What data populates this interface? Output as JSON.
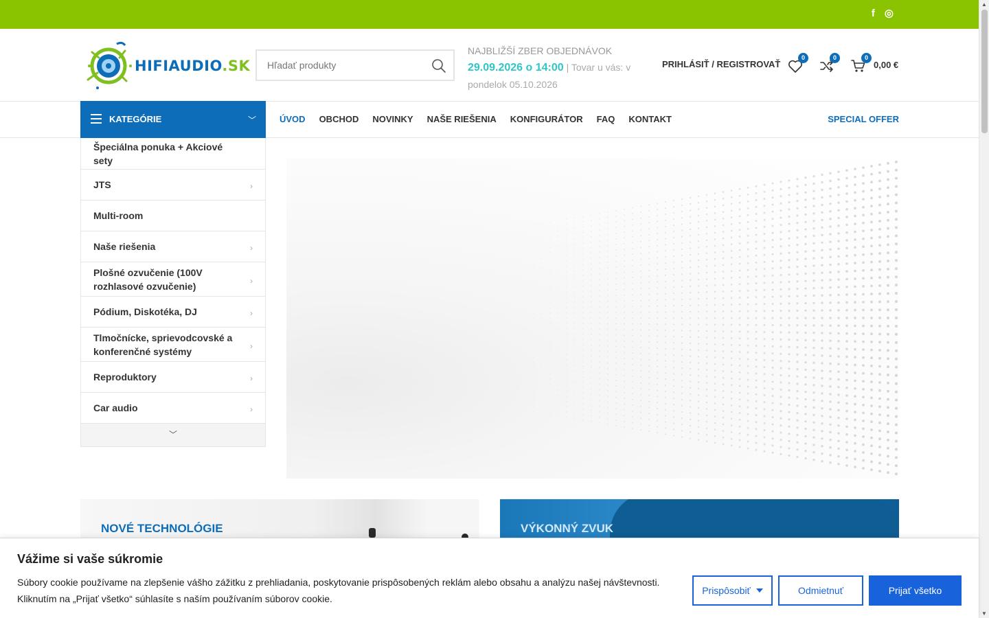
{
  "colors": {
    "topbar": "#8ac300",
    "primary": "#0e6db8",
    "delivery_date": "#2ec6c6",
    "cookie_button": "#1863dc"
  },
  "topbar": {
    "social": [
      {
        "icon": "facebook-icon",
        "glyph": "f"
      },
      {
        "icon": "instagram-icon",
        "glyph": "◎"
      }
    ]
  },
  "header": {
    "logo_text_main": "HIFIAUDIO",
    "logo_text_tld": ".SK",
    "search_placeholder": "Hľadať produkty",
    "delivery": {
      "label": "NAJBLIŽŠÍ ZBER OBJEDNÁVOK",
      "date": "29.09.2026 o 14:00",
      "note": "| Tovar u vás: v pondelok 05.10.2026"
    },
    "account_label": "PRIHLÁSIŤ / REGISTROVAŤ",
    "wishlist_count": "0",
    "compare_count": "0",
    "cart_count": "0",
    "cart_total": "0,00 €"
  },
  "nav": {
    "categories_label": "KATEGÓRIE",
    "items": [
      "ÚVOD",
      "OBCHOD",
      "NOVINKY",
      "NAŠE RIEŠENIA",
      "KONFIGURÁTOR",
      "FAQ",
      "KONTAKT"
    ],
    "active": "ÚVOD",
    "special_offer": "SPECIAL OFFER"
  },
  "categories": [
    {
      "label": "Špeciálna ponuka + Akciové sety",
      "has_sub": false
    },
    {
      "label": "JTS",
      "has_sub": true
    },
    {
      "label": "Multi-room",
      "has_sub": false
    },
    {
      "label": "Naše riešenia",
      "has_sub": true
    },
    {
      "label": "Plošné ozvučenie (100V rozhlasové ozvučenie)",
      "has_sub": true
    },
    {
      "label": "Pódium, Diskotéka, DJ",
      "has_sub": true
    },
    {
      "label": "Tlmočnícke, sprievodcovské a konferenčné systémy",
      "has_sub": true
    },
    {
      "label": "Reproduktory",
      "has_sub": true
    },
    {
      "label": "Car audio",
      "has_sub": true
    }
  ],
  "promos": {
    "left_title": "NOVÉ TECHNOLÓGIE",
    "right_title": "VÝKONNÝ ZVUK"
  },
  "cookie": {
    "title": "Vážime si vaše súkromie",
    "text": "Súbory cookie používame na zlepšenie vášho zážitku z prehliadania, poskytovanie prispôsobených reklám alebo obsahu a analýzu našej návštevnosti. Kliknutím na „Prijať všetko“ súhlasíte s naším používaním súborov cookie.",
    "customize_label": "Prispôsobiť",
    "reject_label": "Odmietnuť",
    "accept_label": "Prijať všetko"
  }
}
